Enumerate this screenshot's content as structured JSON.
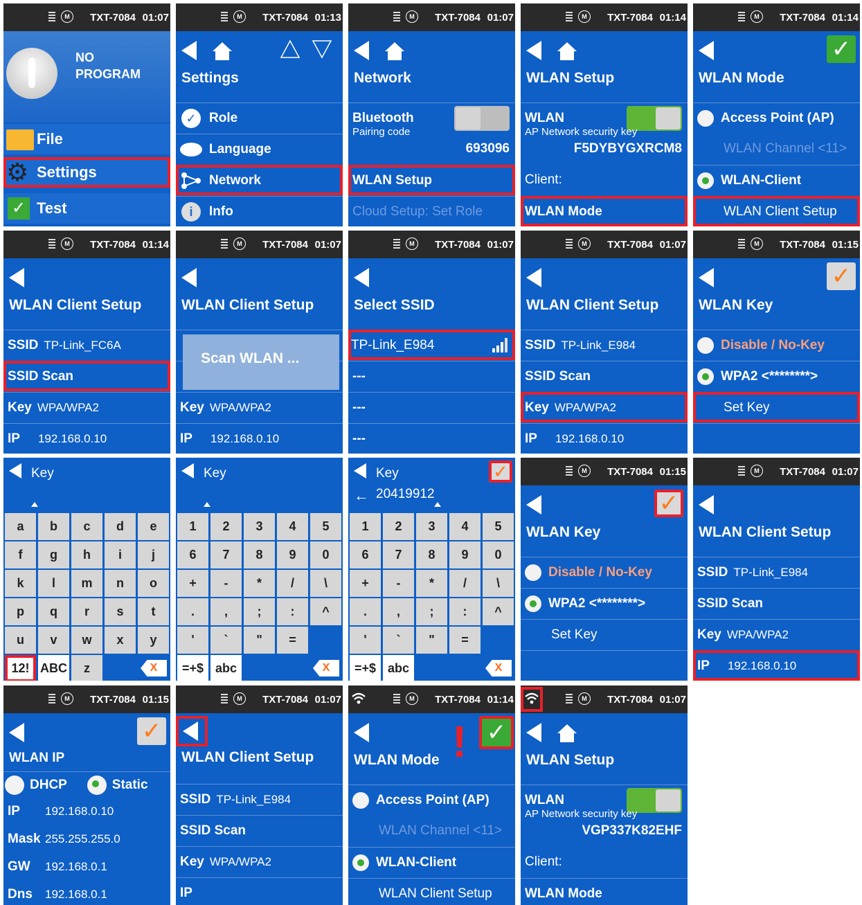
{
  "status": {
    "device": "TXT-7084",
    "modem_icon": "M",
    "times": [
      "01:07",
      "01:13",
      "01:07",
      "01:14",
      "01:14",
      "01:14",
      "01:07",
      "01:07",
      "01:07",
      "01:15",
      "01:15",
      "01:07",
      "01:15",
      "01:07",
      "01:14",
      "01:07"
    ]
  },
  "s1": {
    "no_program": "NO",
    "no_program2": "PROGRAM",
    "file": "File",
    "settings": "Settings",
    "test": "Test"
  },
  "s2": {
    "title": "Settings",
    "role": "Role",
    "language": "Language",
    "network": "Network",
    "info": "Info"
  },
  "s3": {
    "title": "Network",
    "bluetooth": "Bluetooth",
    "pairing_label": "Pairing code",
    "pairing_code": "693096",
    "wlan_setup": "WLAN Setup",
    "cloud": "Cloud Setup: Set Role"
  },
  "s4": {
    "title": "WLAN Setup",
    "wlan": "WLAN",
    "ap_key_label": "AP Network security key",
    "ap_key": "F5DYBYGXRCM8",
    "client": "Client:",
    "wlan_mode": "WLAN Mode"
  },
  "s5": {
    "title": "WLAN Mode",
    "ap": "Access Point (AP)",
    "channel": "WLAN Channel <11>",
    "client": "WLAN-Client",
    "client_setup": "WLAN Client Setup",
    "ok": "✓"
  },
  "s6": {
    "title": "WLAN Client Setup",
    "ssid": "SSID",
    "ssid_val": "TP-Link_FC6A",
    "scan": "SSID Scan",
    "key": "Key",
    "key_val": "WPA/WPA2",
    "ip": "IP",
    "ip_val": "192.168.0.10"
  },
  "s7": {
    "title": "WLAN Client Setup",
    "popup": "Scan WLAN ...",
    "key": "Key",
    "key_val": "WPA/WPA2",
    "ip": "IP",
    "ip_val": "192.168.0.10"
  },
  "s8": {
    "title": "Select SSID",
    "ssid1": "TP-Link_E984",
    "ssid2": "---",
    "ssid3": "---",
    "ssid4": "---"
  },
  "s9": {
    "title": "WLAN Client Setup",
    "ssid": "SSID",
    "ssid_val": "TP-Link_E984",
    "scan": "SSID Scan",
    "key": "Key",
    "key_val": "WPA/WPA2",
    "ip": "IP",
    "ip_val": "192.168.0.10"
  },
  "s10": {
    "title": "WLAN Key",
    "disable": "Disable / No-Key",
    "wpa2": "WPA2 <********>",
    "set_key": "Set Key",
    "ok": "✓"
  },
  "k1": {
    "label": "Key",
    "rows": [
      [
        "a",
        "b",
        "c",
        "d",
        "e"
      ],
      [
        "f",
        "g",
        "h",
        "i",
        "j"
      ],
      [
        "k",
        "l",
        "m",
        "n",
        "o"
      ],
      [
        "p",
        "q",
        "r",
        "s",
        "t"
      ],
      [
        "u",
        "v",
        "w",
        "x",
        "y"
      ]
    ],
    "last": [
      "12!",
      "ABC",
      "z"
    ],
    "del": "X"
  },
  "k2": {
    "label": "Key",
    "rows": [
      [
        "1",
        "2",
        "3",
        "4",
        "5"
      ],
      [
        "6",
        "7",
        "8",
        "9",
        "0"
      ],
      [
        "+",
        "-",
        "*",
        "/",
        "\\"
      ],
      [
        ".",
        ",",
        ";",
        ":",
        "^"
      ],
      [
        "'",
        "`",
        "\"",
        "="
      ]
    ],
    "last": [
      "=+$",
      "abc"
    ],
    "del": "X"
  },
  "k3": {
    "label": "Key",
    "value": "20419912",
    "ok": "✓",
    "rows": [
      [
        "1",
        "2",
        "3",
        "4",
        "5"
      ],
      [
        "6",
        "7",
        "8",
        "9",
        "0"
      ],
      [
        "+",
        "-",
        "*",
        "/",
        "\\"
      ],
      [
        ".",
        ",",
        ";",
        ":",
        "^"
      ],
      [
        "'",
        "`",
        "\"",
        "="
      ]
    ],
    "last": [
      "=+$",
      "abc"
    ],
    "del": "X"
  },
  "s14": {
    "title": "WLAN Key",
    "disable": "Disable / No-Key",
    "wpa2": "WPA2 <********>",
    "set_key": "Set Key",
    "ok": "✓"
  },
  "s15": {
    "title": "WLAN Client Setup",
    "ssid": "SSID",
    "ssid_val": "TP-Link_E984",
    "scan": "SSID Scan",
    "key": "Key",
    "key_val": "WPA/WPA2",
    "ip": "IP",
    "ip_val": "192.168.0.10"
  },
  "s16": {
    "title": "WLAN IP",
    "dhcp": "DHCP",
    "static": "Static",
    "ip": "IP",
    "ip_val": "192.168.0.10",
    "mask": "Mask",
    "mask_val": "255.255.255.0",
    "gw": "GW",
    "gw_val": "192.168.0.1",
    "dns": "Dns",
    "dns_val": "192.168.0.1",
    "ok": "✓"
  },
  "s17": {
    "title": "WLAN Client Setup",
    "ssid": "SSID",
    "ssid_val": "TP-Link_E984",
    "scan": "SSID Scan",
    "key": "Key",
    "key_val": "WPA/WPA2",
    "ip": "IP"
  },
  "s18": {
    "title": "WLAN Mode",
    "ap": "Access Point (AP)",
    "channel": "WLAN Channel <11>",
    "client": "WLAN-Client",
    "client_setup": "WLAN Client Setup",
    "ok": "✓",
    "alert": "!"
  },
  "s19": {
    "title": "WLAN Setup",
    "wlan": "WLAN",
    "ap_key_label": "AP Network security key",
    "ap_key": "VGP337K82EHF",
    "client": "Client:",
    "wlan_mode": "WLAN Mode"
  }
}
